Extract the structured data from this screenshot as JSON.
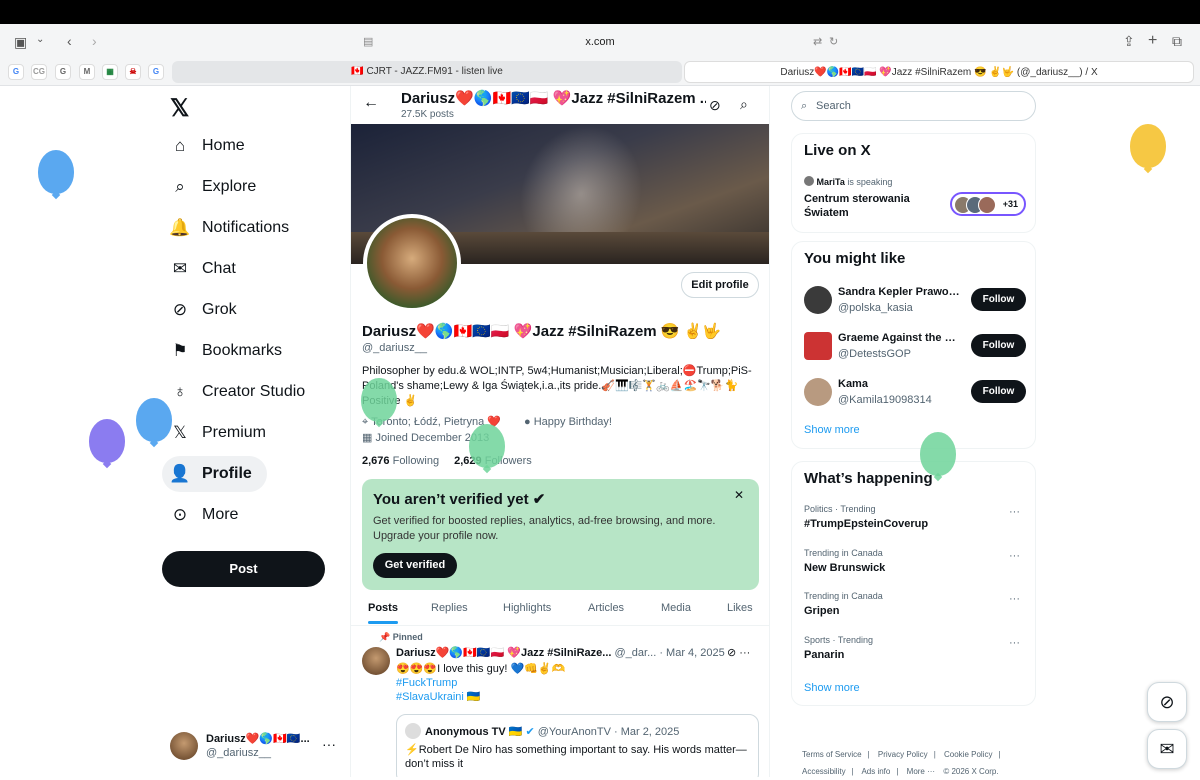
{
  "browser": {
    "url": "x.com",
    "tabs": [
      {
        "title": "🇨🇦 CJRT - JAZZ.FM91 - listen live"
      },
      {
        "title": "Dariusz❤️🌎🇨🇦🇪🇺🇵🇱 💖Jazz #SilniRazem 😎 ✌️🤟 (@_dariusz__) / X"
      }
    ],
    "favicons": [
      "G",
      "CG",
      "G",
      "M",
      "▦",
      "☠",
      "G"
    ]
  },
  "nav": {
    "items": [
      {
        "label": "Home",
        "icon": "home-icon",
        "glyph": "⌂"
      },
      {
        "label": "Explore",
        "icon": "search-icon",
        "glyph": "⌕"
      },
      {
        "label": "Notifications",
        "icon": "bell-icon",
        "glyph": "🔔"
      },
      {
        "label": "Chat",
        "icon": "mail-icon",
        "glyph": "✉"
      },
      {
        "label": "Grok",
        "icon": "grok-icon",
        "glyph": "⊘"
      },
      {
        "label": "Bookmarks",
        "icon": "bookmark-icon",
        "glyph": "⚑"
      },
      {
        "label": "Creator Studio",
        "icon": "creator-studio-icon",
        "glyph": "♁"
      },
      {
        "label": "Premium",
        "icon": "x-logo-icon",
        "glyph": "𝕏"
      },
      {
        "label": "Profile",
        "icon": "person-icon",
        "glyph": "👤"
      },
      {
        "label": "More",
        "icon": "more-circle-icon",
        "glyph": "⊙"
      }
    ],
    "post_label": "Post",
    "account": {
      "name": "Dariusz❤️🌎🇨🇦🇪🇺...",
      "handle": "@_dariusz__"
    }
  },
  "profile": {
    "header_name": "Dariusz❤️🌎🇨🇦🇪🇺🇵🇱 💖Jazz #SilniRazem ...",
    "post_count": "27.5K posts",
    "edit_label": "Edit profile",
    "name": "Dariusz❤️🌎🇨🇦🇪🇺🇵🇱 💖Jazz #SilniRazem 😎 ✌️🤟",
    "handle": "@_dariusz__",
    "bio": "Philosopher by edu.& WOL;INTP, 5w4;Humanist;Musician;Liberal;⛔Trump;PiS-Poland's shame;Lewy & Iga Świątek,i.a.,its pride.🎻🎹🎼🏋️🚲⛵🏖️🔭🐕🐈 Positive ✌️",
    "location": "Toronto; Łódź, Pietryna ❤️",
    "birthday": "Happy Birthday!",
    "joined": "Joined December 2013",
    "following_count": "2,676",
    "following_label": "Following",
    "followers_count": "2,629",
    "followers_label": "Followers"
  },
  "verify": {
    "title": "You aren’t verified yet",
    "description": "Get verified for boosted replies, analytics, ad-free browsing, and more. Upgrade your profile now.",
    "button": "Get verified"
  },
  "tabs": [
    "Posts",
    "Replies",
    "Highlights",
    "Articles",
    "Media",
    "Likes"
  ],
  "pinned_post": {
    "pinned_label": "Pinned",
    "author": "Dariusz❤️🌎🇨🇦🇪🇺🇵🇱 💖Jazz #SilniRaze...",
    "handle": "@_dar...",
    "date": "· Mar 4, 2025",
    "text": "😍😍😍I love this guy! 💙👊✌️🫶",
    "tag1": "#FuckTrump",
    "tag2": "#SlavaUkraini 🇺🇦",
    "quote": {
      "author": "Anonymous TV 🇺🇦",
      "handle": "@YourAnonTV",
      "date": "· Mar 2, 2025",
      "text": "⚡Robert De Niro has something important to say. His words matter—don’t miss it"
    }
  },
  "sidebar": {
    "search_placeholder": "Search",
    "live": {
      "title": "Live on X",
      "speaker": "MariTa",
      "speaking": "is speaking",
      "room": "Centrum sterowania Światem",
      "count": "+31"
    },
    "like": {
      "title": "You might like",
      "users": [
        {
          "name": "Sandra Kepler Prawo i ...",
          "handle": "@polska_kasia"
        },
        {
          "name": "Graeme Against the Pe...",
          "handle": "@DetestsGOP"
        },
        {
          "name": "Kama",
          "handle": "@Kamila19098314"
        }
      ],
      "follow_label": "Follow",
      "show_more": "Show more"
    },
    "happening": {
      "title": "What’s happening",
      "trends": [
        {
          "context": "Politics · Trending",
          "name": "#TrumpEpsteinCoverup"
        },
        {
          "context": "Trending in Canada",
          "name": "New Brunswick"
        },
        {
          "context": "Trending in Canada",
          "name": "Gripen"
        },
        {
          "context": "Sports · Trending",
          "name": "Panarin"
        }
      ],
      "show_more": "Show more"
    },
    "footer": [
      "Terms of Service",
      "|",
      "Privacy Policy",
      "|",
      "Cookie Policy",
      "|",
      "Accessibility",
      "|",
      "Ads info",
      "|",
      "More ···",
      "© 2026 X Corp."
    ]
  },
  "colors": {
    "accent": "#1d9bf0",
    "verify_bg": "#b7e5c6",
    "balloon_blue": "#5aa8f0",
    "balloon_purple": "#8b7cf0",
    "balloon_green": "#6fd39a",
    "balloon_yellow": "#f6c844"
  }
}
